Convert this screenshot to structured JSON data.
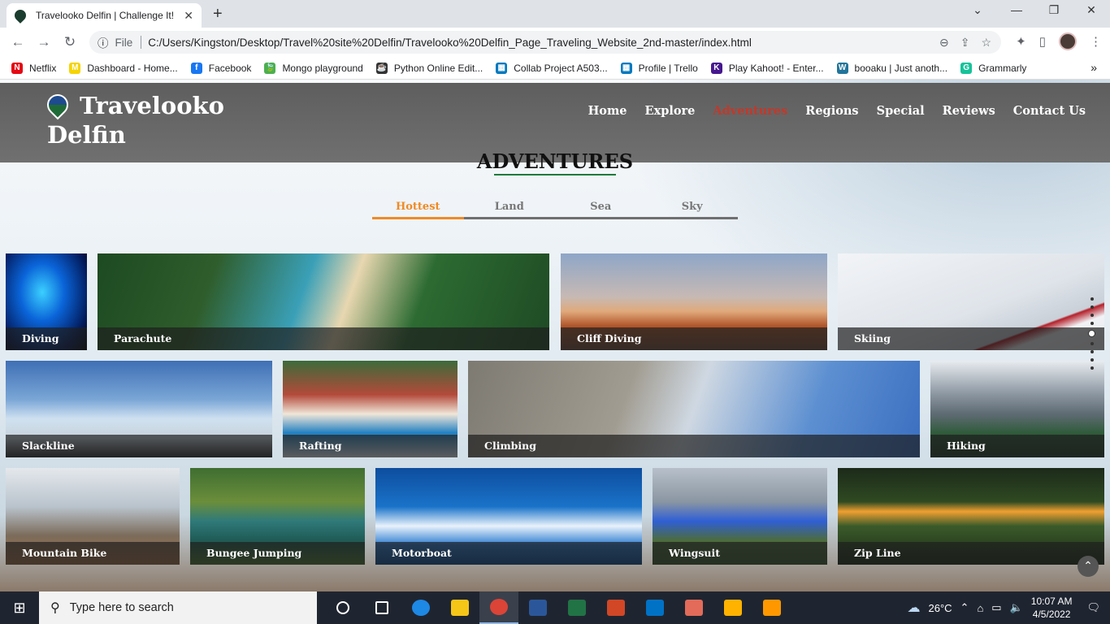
{
  "browser": {
    "tab_title": "Travelooko Delfin | Challenge It!",
    "tab_close": "✕",
    "new_tab": "+",
    "url_scheme_label": "File",
    "url": "C:/Users/Kingston/Desktop/Travel%20site%20Delfin/Travelooko%20Delfin_Page_Traveling_Website_2nd-master/index.html",
    "bookmarks": [
      {
        "label": "Netflix",
        "color": "#e50914",
        "glyph": "N"
      },
      {
        "label": "Dashboard - Home...",
        "color": "#f5d400",
        "glyph": "M"
      },
      {
        "label": "Facebook",
        "color": "#1877f2",
        "glyph": "f"
      },
      {
        "label": "Mongo playground",
        "color": "#4caf50",
        "glyph": "🍃"
      },
      {
        "label": "Python Online Edit...",
        "color": "#333333",
        "glyph": "☕"
      },
      {
        "label": "Collab Project A503...",
        "color": "#0079bf",
        "glyph": "▦"
      },
      {
        "label": "Profile | Trello",
        "color": "#0079bf",
        "glyph": "▦"
      },
      {
        "label": "Play Kahoot! - Enter...",
        "color": "#46178f",
        "glyph": "K"
      },
      {
        "label": "booaku | Just anoth...",
        "color": "#21759b",
        "glyph": "W"
      },
      {
        "label": "Grammarly",
        "color": "#15c39a",
        "glyph": "G"
      }
    ],
    "bookmarks_more": "»"
  },
  "site": {
    "logo_line1": "Travelooko",
    "logo_line2": "Delfin",
    "nav": [
      "Home",
      "Explore",
      "Adventures",
      "Regions",
      "Special",
      "Reviews",
      "Contact Us"
    ],
    "nav_active": "Adventures",
    "section_title": "ADVENTURES",
    "tabs": [
      "Hottest",
      "Land",
      "Sea",
      "Sky"
    ],
    "active_tab": "Hottest",
    "cards": [
      {
        "label": "Diving",
        "bg": "radial-gradient(ellipse at 45% 40%,#3bd0ff 0%,#0a64d8 35%,#021a5a 75%,#000 100%)"
      },
      {
        "label": "Parachute",
        "bg": "linear-gradient(110deg,#1d4a22 0%,#2f5d2b 25%,#3aa0b7 45%,#e8d7b0 55%,#2c6b32 70%,#1f4a24 100%)"
      },
      {
        "label": "Cliff Diving",
        "bg": "linear-gradient(180deg,#8ea6c7 0%,#c7b9b4 45%,#e0a97a 60%,#b0552a 75%,#6d4a3a 100%)"
      },
      {
        "label": "Skiing",
        "bg": "linear-gradient(160deg,#f2f4f7 0%,#dfe4ea 55%,#c9d0d8 75%,#b5202a 76%,#f0f2f5 82%,#e5e8ec 100%)"
      },
      {
        "label": "Slackline",
        "bg": "linear-gradient(180deg,#3f6fb5 0%,#7aa6d6 40%,#cfe1f0 60%,#c8d3dc 80%,#2d2f33 100%)"
      },
      {
        "label": "Rafting",
        "bg": "linear-gradient(180deg,#3c6b3a 0%,#b34a3a 35%,#f0e6d8 55%,#1f7fc1 75%,#e8eef4 100%)"
      },
      {
        "label": "Climbing",
        "bg": "linear-gradient(110deg,#7d7a72 0%,#a19c91 35%,#cfd8e2 50%,#5c8fd1 75%,#3b6fc0 100%)"
      },
      {
        "label": "Hiking",
        "bg": "linear-gradient(180deg,#e8ecf0 0%,#8a95a0 35%,#5f6b73 55%,#2f5b3a 75%,#1e3b28 100%)"
      },
      {
        "label": "Mountain Bike",
        "bg": "linear-gradient(180deg,#e4e8ec 0%,#b9c3cc 40%,#7b6b5a 70%,#a8734a 100%)"
      },
      {
        "label": "Bungee Jumping",
        "bg": "linear-gradient(180deg,#3f6e31 0%,#6b8e3b 35%,#2f7a7a 55%,#1f5a55 75%,#4f7a2f 100%)"
      },
      {
        "label": "Motorboat",
        "bg": "linear-gradient(180deg,#0d4d9e 0%,#1a73c9 40%,#e9f2fb 60%,#2b7bd0 80%,#0b4e96 100%)"
      },
      {
        "label": "Wingsuit",
        "bg": "linear-gradient(180deg,#b7c0ca 0%,#8a96a2 35%,#2f5fd4 55%,#4c6c3c 75%,#3a5a30 100%)"
      },
      {
        "label": "Zip Line",
        "bg": "linear-gradient(180deg,#1c2a1a 0%,#2f4a22 35%,#f0a030 45%,#3b5a2a 60%,#1a2a16 100%)"
      }
    ]
  },
  "taskbar": {
    "search_placeholder": "Type here to search",
    "weather": "26°C",
    "time": "10:07 AM",
    "date": "4/5/2022",
    "apps": [
      {
        "name": "task-view",
        "color": "#ffffff"
      },
      {
        "name": "widgets",
        "color": "#ffffff"
      },
      {
        "name": "edge",
        "color": "#1e88e5"
      },
      {
        "name": "file-explorer",
        "color": "#f5c518"
      },
      {
        "name": "chrome",
        "color": "#db4437"
      },
      {
        "name": "word",
        "color": "#2b579a"
      },
      {
        "name": "excel",
        "color": "#217346"
      },
      {
        "name": "powerpoint",
        "color": "#d24726"
      },
      {
        "name": "outlook",
        "color": "#0072c6"
      },
      {
        "name": "paint",
        "color": "#e26b5a"
      },
      {
        "name": "snipping",
        "color": "#ffb300"
      },
      {
        "name": "sublime",
        "color": "#ff9800"
      }
    ]
  }
}
